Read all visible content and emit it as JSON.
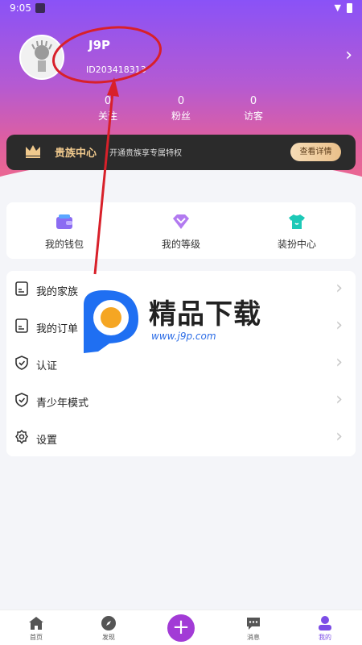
{
  "status_bar": {
    "time": "9:05"
  },
  "profile": {
    "name": "J9P",
    "id": "ID203418313"
  },
  "stats": [
    {
      "value": "0",
      "label": "关注"
    },
    {
      "value": "0",
      "label": "粉丝"
    },
    {
      "value": "0",
      "label": "访客"
    }
  ],
  "noble": {
    "title": "贵族中心",
    "subtitle": "开通贵族享专属特权",
    "button": "查看详情"
  },
  "quick": [
    {
      "label": "我的钱包",
      "icon": "wallet-icon"
    },
    {
      "label": "我的等级",
      "icon": "level-icon"
    },
    {
      "label": "装扮中心",
      "icon": "dress-up-icon"
    }
  ],
  "menu": [
    {
      "label": "我的家族",
      "icon": "document-icon"
    },
    {
      "label": "我的订单",
      "icon": "document-icon"
    },
    {
      "label": "认证",
      "icon": "shield-icon"
    },
    {
      "label": "青少年模式",
      "icon": "shield-icon"
    },
    {
      "label": "设置",
      "icon": "gear-icon"
    }
  ],
  "watermark": {
    "text": "精品下载",
    "url": "www.j9p.com"
  },
  "tabs": [
    {
      "label": "首页",
      "icon": "home-icon"
    },
    {
      "label": "发现",
      "icon": "compass-icon"
    },
    {
      "label": "",
      "icon": "plus-icon"
    },
    {
      "label": "消息",
      "icon": "message-icon"
    },
    {
      "label": "我的",
      "icon": "profile-icon"
    }
  ],
  "colors": {
    "accent": "#7c4de6",
    "plus": "#a23bd6",
    "noble_gold": "#f0c98d"
  }
}
